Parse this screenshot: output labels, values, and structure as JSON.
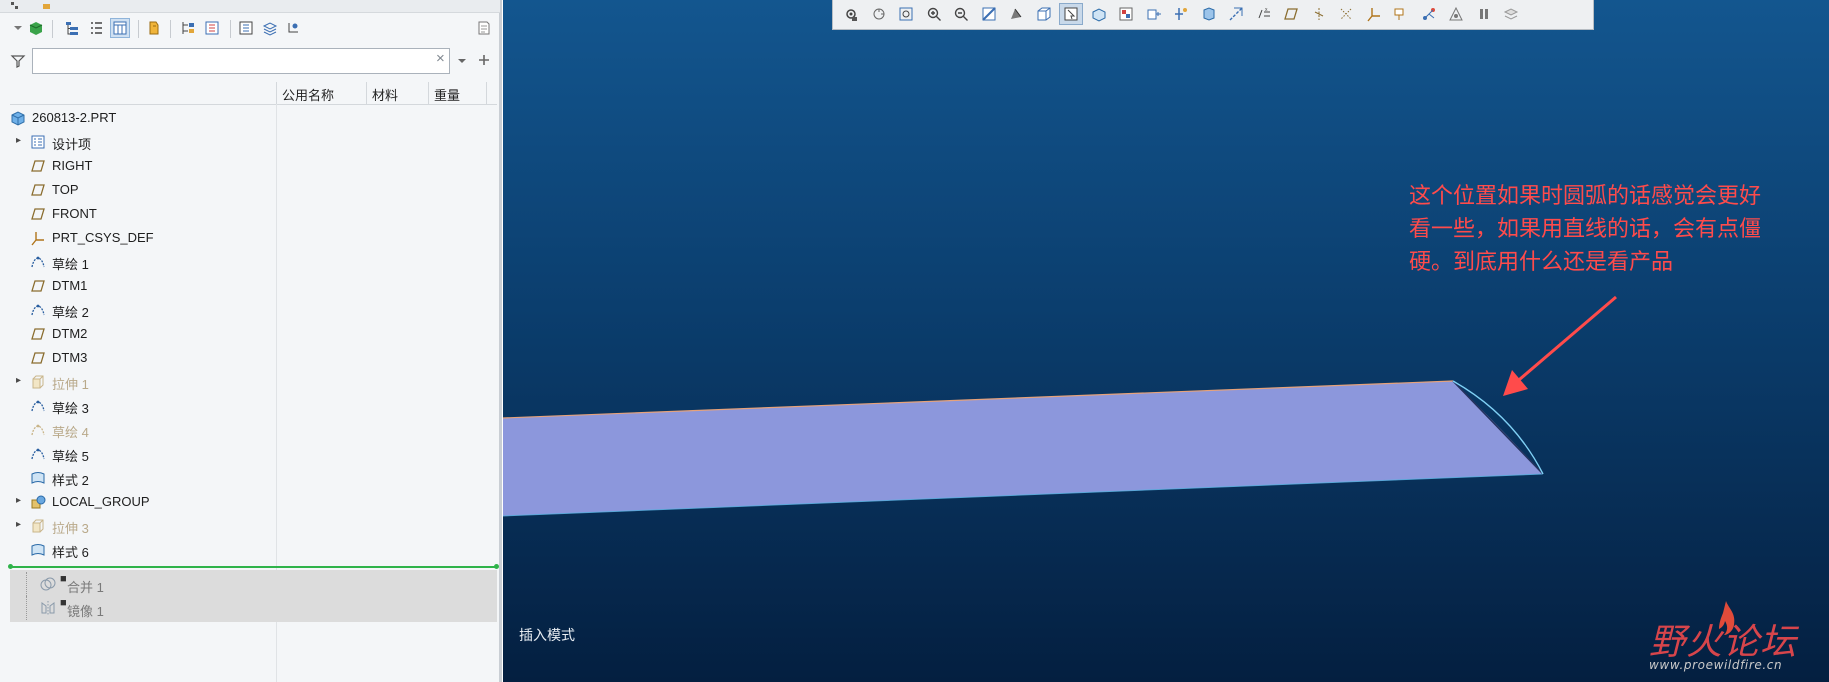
{
  "model_tree": {
    "search": {
      "value": "",
      "placeholder": "",
      "clear_symbol": "×"
    },
    "columns": [
      "公用名称",
      "材料",
      "重量"
    ],
    "root": {
      "label": "260813-2.PRT",
      "icon": "part-icon"
    },
    "items": [
      {
        "label": "设计项",
        "icon": "design-items-icon",
        "expandable": true,
        "suppressed": false
      },
      {
        "label": "RIGHT",
        "icon": "datum-plane-icon",
        "expandable": false,
        "suppressed": false
      },
      {
        "label": "TOP",
        "icon": "datum-plane-icon",
        "expandable": false,
        "suppressed": false
      },
      {
        "label": "FRONT",
        "icon": "datum-plane-icon",
        "expandable": false,
        "suppressed": false
      },
      {
        "label": "PRT_CSYS_DEF",
        "icon": "csys-icon",
        "expandable": false,
        "suppressed": false
      },
      {
        "label": "草绘 1",
        "icon": "sketch-icon",
        "expandable": false,
        "suppressed": false
      },
      {
        "label": "DTM1",
        "icon": "datum-plane-icon",
        "expandable": false,
        "suppressed": false
      },
      {
        "label": "草绘 2",
        "icon": "sketch-icon",
        "expandable": false,
        "suppressed": false
      },
      {
        "label": "DTM2",
        "icon": "datum-plane-icon",
        "expandable": false,
        "suppressed": false
      },
      {
        "label": "DTM3",
        "icon": "datum-plane-icon",
        "expandable": false,
        "suppressed": false
      },
      {
        "label": "拉伸 1",
        "icon": "extrude-icon",
        "expandable": true,
        "suppressed": true
      },
      {
        "label": "草绘 3",
        "icon": "sketch-icon",
        "expandable": false,
        "suppressed": false
      },
      {
        "label": "草绘 4",
        "icon": "sketch-icon",
        "expandable": false,
        "suppressed": true
      },
      {
        "label": "草绘 5",
        "icon": "sketch-icon",
        "expandable": false,
        "suppressed": false
      },
      {
        "label": "样式 2",
        "icon": "style-icon",
        "expandable": false,
        "suppressed": false
      },
      {
        "label": "LOCAL_GROUP",
        "icon": "group-icon",
        "expandable": true,
        "suppressed": false
      },
      {
        "label": "拉伸 3",
        "icon": "extrude-icon",
        "expandable": true,
        "suppressed": true
      },
      {
        "label": "样式 6",
        "icon": "style-icon",
        "expandable": false,
        "suppressed": false
      }
    ],
    "after_insert": [
      {
        "label": "合并 1",
        "icon": "merge-icon"
      },
      {
        "label": "镜像 1",
        "icon": "mirror-icon"
      }
    ]
  },
  "viewport": {
    "annotation": [
      "这个位置如果时圆弧的话感觉会更好",
      "看一些，如果用直线的话，会有点僵",
      "硬。到底用什么还是看产品"
    ],
    "mode_label": "插入模式",
    "watermark": {
      "title": "野火论坛",
      "url": "www.proewildfire.cn"
    }
  },
  "colors": {
    "viewport_top": "#13568f",
    "viewport_bottom": "#041f40",
    "surface": "#8c97dc",
    "annotation": "#ff4b4b",
    "insert_line": "#2fb34a"
  }
}
